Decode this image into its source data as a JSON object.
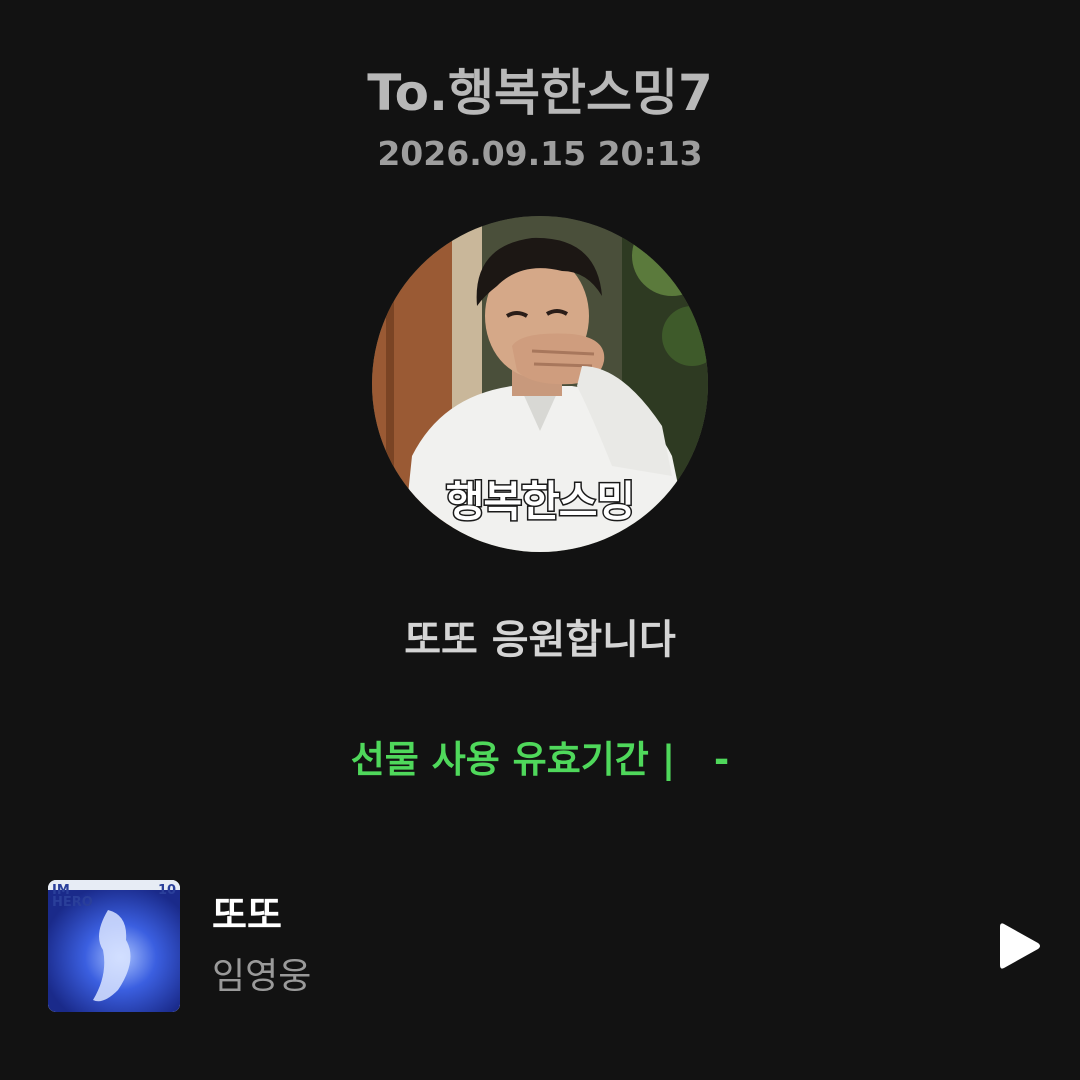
{
  "header": {
    "title": "To.행복한스밍7",
    "timestamp": "2026.09.15 20:13"
  },
  "avatar": {
    "caption": "행복한스밍"
  },
  "message": "또또 응원합니다",
  "expiry": {
    "label": "선물 사용 유효기간 |   -"
  },
  "music": {
    "song_title": "또또",
    "artist": "임영웅",
    "album_art_text": "IM HERO",
    "play_icon": "play-icon"
  },
  "colors": {
    "background": "#121212",
    "accent_green": "#4fd85b",
    "title_gray": "#b8b8b8"
  }
}
